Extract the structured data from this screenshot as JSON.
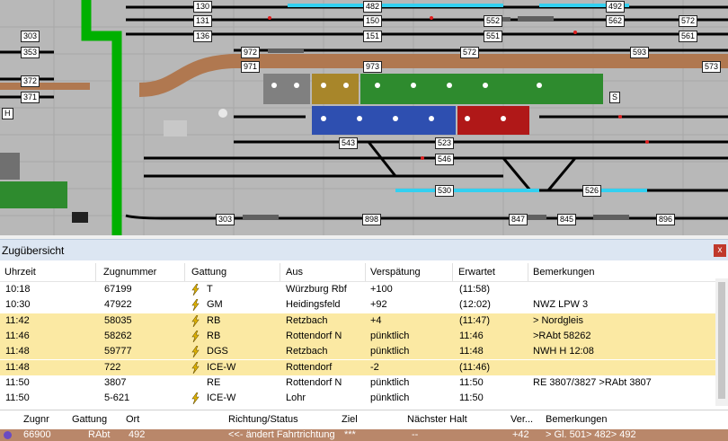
{
  "diagram": {
    "block_labels": [
      "130",
      "131",
      "136",
      "303",
      "353",
      "372",
      "371",
      "H",
      "972",
      "971",
      "973",
      "482",
      "150",
      "151",
      "552",
      "551",
      "572",
      "593",
      "492",
      "562",
      "561",
      "572",
      "573",
      "S",
      "543",
      "523",
      "546",
      "530",
      "526",
      "303",
      "898",
      "847",
      "845",
      "896"
    ],
    "colors": {
      "background": "#b8b8b8",
      "track": "#000000",
      "green_track": "#00b000",
      "brown_track": "#b07850",
      "cyan_track": "#33d0f0"
    }
  },
  "panel": {
    "title": "Zugübersicht",
    "close_label": "x",
    "columns": [
      "Uhrzeit",
      "Zugnummer",
      "Gattung",
      "Aus",
      "Verspätung",
      "Erwartet",
      "Bemerkungen"
    ],
    "rows": [
      {
        "uhrzeit": "10:18",
        "zugnummer": "67199",
        "gattung": "T",
        "aus": "Würzburg Rbf",
        "verspaetung": "+100",
        "erwartet": "(11:58)",
        "bemerkungen": "",
        "highlight": false,
        "bolt": true
      },
      {
        "uhrzeit": "10:30",
        "zugnummer": "47922",
        "gattung": "GM",
        "aus": "Heidingsfeld",
        "verspaetung": "+92",
        "erwartet": "(12:02)",
        "bemerkungen": "NWZ LPW 3",
        "highlight": false,
        "bolt": true
      },
      {
        "uhrzeit": "11:42",
        "zugnummer": "58035",
        "gattung": "RB",
        "aus": "Retzbach",
        "verspaetung": "+4",
        "erwartet": "(11:47)",
        "bemerkungen": "> Nordgleis",
        "highlight": true,
        "bolt": true
      },
      {
        "uhrzeit": "11:46",
        "zugnummer": "58262",
        "gattung": "RB",
        "aus": "Rottendorf N",
        "verspaetung": "pünktlich",
        "erwartet": "11:46",
        "bemerkungen": ">RAbt 58262",
        "highlight": true,
        "bolt": true
      },
      {
        "uhrzeit": "11:48",
        "zugnummer": "59777",
        "gattung": "DGS",
        "aus": "Retzbach",
        "verspaetung": "pünktlich",
        "erwartet": "11:48",
        "bemerkungen": "NWH H 12:08",
        "highlight": true,
        "bolt": true
      },
      {
        "uhrzeit": "11:48",
        "zugnummer": "722",
        "gattung": "ICE-W",
        "aus": "Rottendorf",
        "verspaetung": "-2",
        "erwartet": "(11:46)",
        "bemerkungen": "",
        "highlight": true,
        "bolt": true
      },
      {
        "uhrzeit": "11:50",
        "zugnummer": "3807",
        "gattung": "RE",
        "aus": "Rottendorf N",
        "verspaetung": "pünktlich",
        "erwartet": "11:50",
        "bemerkungen": "RE 3807/3827    >RAbt 3807",
        "highlight": false,
        "bolt": false
      },
      {
        "uhrzeit": "11:50",
        "zugnummer": "5-621",
        "gattung": "ICE-W",
        "aus": "Lohr",
        "verspaetung": "pünktlich",
        "erwartet": "11:50",
        "bemerkungen": "",
        "highlight": false,
        "bolt": true
      }
    ],
    "lower_columns": [
      "Zugnr",
      "Gattung",
      "Ort",
      "Richtung/Status",
      "Ziel",
      "Nächster Halt",
      "Ver...",
      "Bemerkungen"
    ],
    "lower_row": {
      "zugnr": "66900",
      "gattung": "RAbt",
      "ort": "492",
      "richtung": "<<- ändert Fahrtrichtung",
      "ziel": "***",
      "naechster_halt": "--",
      "ver": "+42",
      "bemerkungen": "> Gl. 501> 482> 492"
    }
  }
}
